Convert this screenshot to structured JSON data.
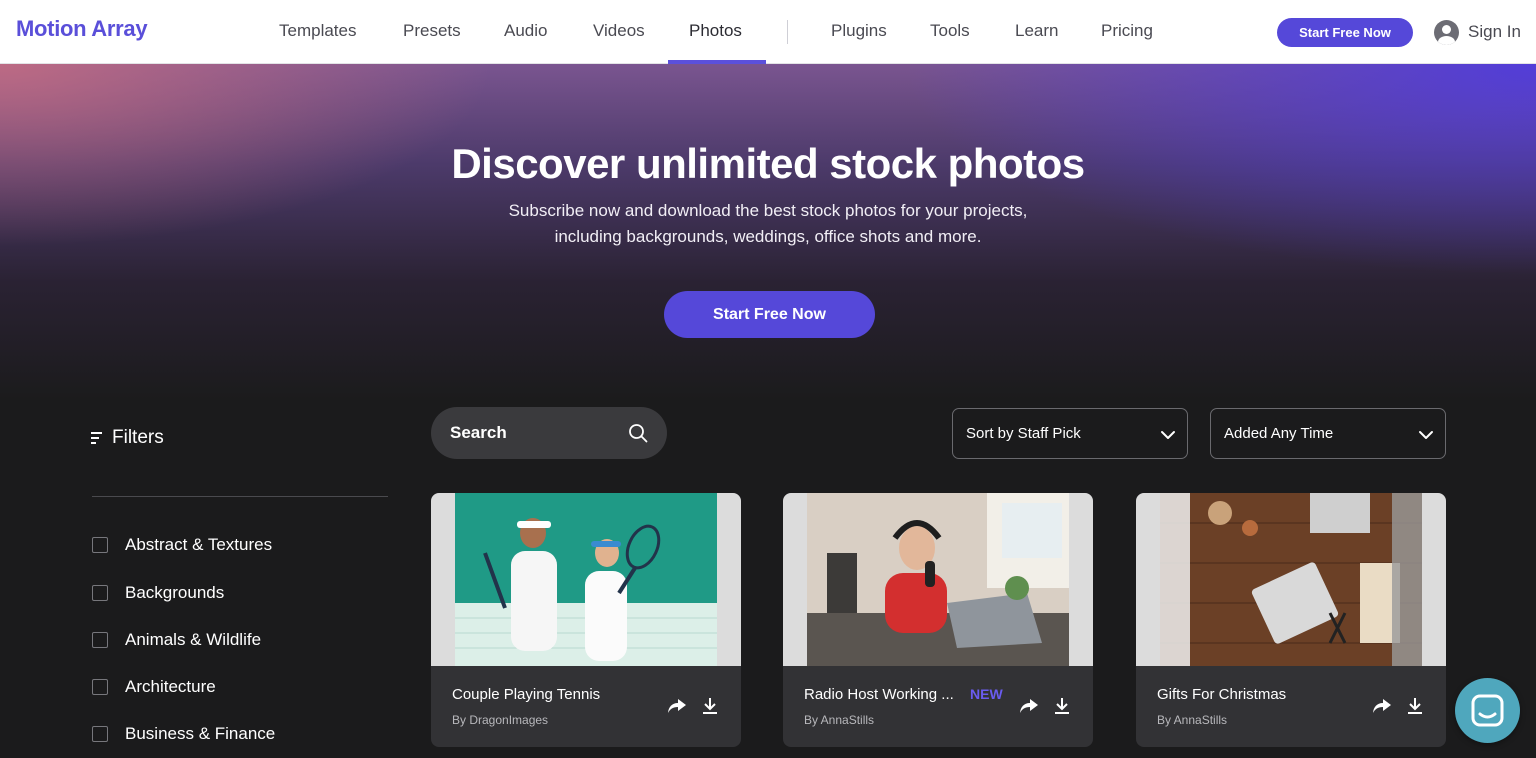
{
  "nav": {
    "logo": "Motion Array",
    "links": [
      "Templates",
      "Presets",
      "Audio",
      "Videos",
      "Photos",
      "Plugins",
      "Tools",
      "Learn",
      "Pricing"
    ],
    "active": "Photos",
    "cta": "Start Free Now",
    "sign_in": "Sign In"
  },
  "hero": {
    "title": "Discover unlimited stock photos",
    "subtitle_line1": "Subscribe now and download the best stock photos for your projects,",
    "subtitle_line2": "including backgrounds, weddings, office shots and more.",
    "cta": "Start Free Now"
  },
  "filters": {
    "title": "Filters",
    "categories": [
      "Abstract & Textures",
      "Backgrounds",
      "Animals & Wildlife",
      "Architecture",
      "Business & Finance"
    ]
  },
  "toolbar": {
    "search_placeholder": "Search",
    "sort_value": "Sort by Staff Pick",
    "time_value": "Added Any Time"
  },
  "cards": [
    {
      "title": "Couple Playing Tennis",
      "author": "By DragonImages",
      "badge": ""
    },
    {
      "title": "Radio Host Working ...",
      "author": "By AnnaStills",
      "badge": "NEW"
    },
    {
      "title": "Gifts For Christmas",
      "author": "By AnnaStills",
      "badge": ""
    }
  ],
  "colors": {
    "accent": "#5548d9",
    "background": "#1b1b1c",
    "card": "#323235",
    "chat": "#4fa7bd"
  },
  "icons": [
    "filter-icon",
    "search-icon",
    "chevron-down-icon",
    "share-icon",
    "download-icon",
    "user-icon",
    "chat-icon"
  ]
}
